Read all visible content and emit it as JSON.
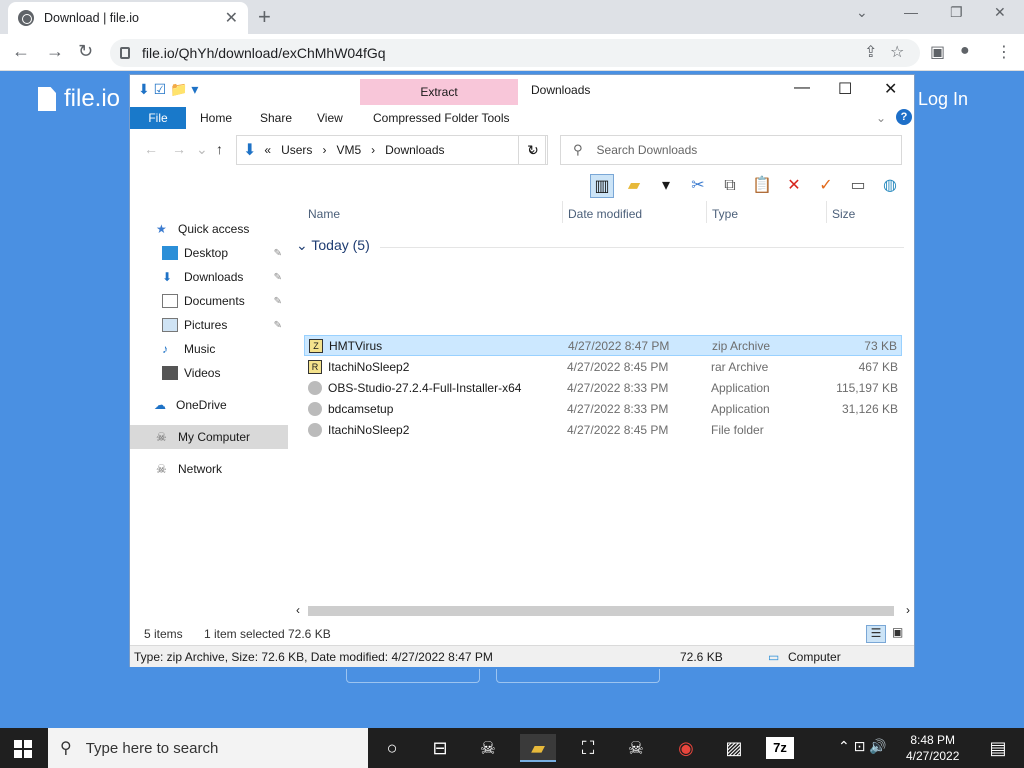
{
  "browser": {
    "tab_title": "Download | file.io",
    "tab_close": "✕",
    "new_tab": "+",
    "url": "file.io/QhYh/download/exChMhW04fGq"
  },
  "page": {
    "logo_text": "file.io",
    "login_text": "Log In"
  },
  "explorer": {
    "window_title": "Downloads",
    "context_tab": "Extract",
    "ribbon_tabs": [
      "File",
      "Home",
      "Share",
      "View",
      "Compressed Folder Tools"
    ],
    "address": {
      "chevron": "«",
      "crumbs": [
        "Users",
        "VM5",
        "Downloads"
      ]
    },
    "search_placeholder": "Search Downloads",
    "nav": {
      "quick_access": "Quick access",
      "desktop": "Desktop",
      "downloads": "Downloads",
      "documents": "Documents",
      "pictures": "Pictures",
      "music": "Music",
      "videos": "Videos",
      "onedrive": "OneDrive",
      "my_computer": "My Computer",
      "network": "Network"
    },
    "columns": {
      "name": "Name",
      "date": "Date modified",
      "type": "Type",
      "size": "Size"
    },
    "group_label": "Today (5)",
    "files": [
      {
        "name": "HMTVirus",
        "date": "4/27/2022 8:47 PM",
        "type": "zip Archive",
        "size": "73 KB",
        "icon": "zip-icon"
      },
      {
        "name": "ItachiNoSleep2",
        "date": "4/27/2022 8:45 PM",
        "type": "rar Archive",
        "size": "467 KB",
        "icon": "rar-icon"
      },
      {
        "name": "OBS-Studio-27.2.4-Full-Installer-x64",
        "date": "4/27/2022 8:33 PM",
        "type": "Application",
        "size": "115,197 KB",
        "icon": "app-icon"
      },
      {
        "name": "bdcamsetup",
        "date": "4/27/2022 8:33 PM",
        "type": "Application",
        "size": "31,126 KB",
        "icon": "app-icon"
      },
      {
        "name": "ItachiNoSleep2",
        "date": "4/27/2022 8:45 PM",
        "type": "File folder",
        "size": "",
        "icon": "folder-icon"
      }
    ],
    "status": {
      "items": "5 items",
      "selected": "1 item selected",
      "selected_size": "72.6 KB"
    },
    "details": {
      "info": "Type: zip Archive, Size: 72.6 KB, Date modified: 4/27/2022 8:47 PM",
      "size": "72.6 KB",
      "location": "Computer"
    }
  },
  "taskbar": {
    "search_placeholder": "Type here to search",
    "time": "8:48 PM",
    "date": "4/27/2022"
  }
}
